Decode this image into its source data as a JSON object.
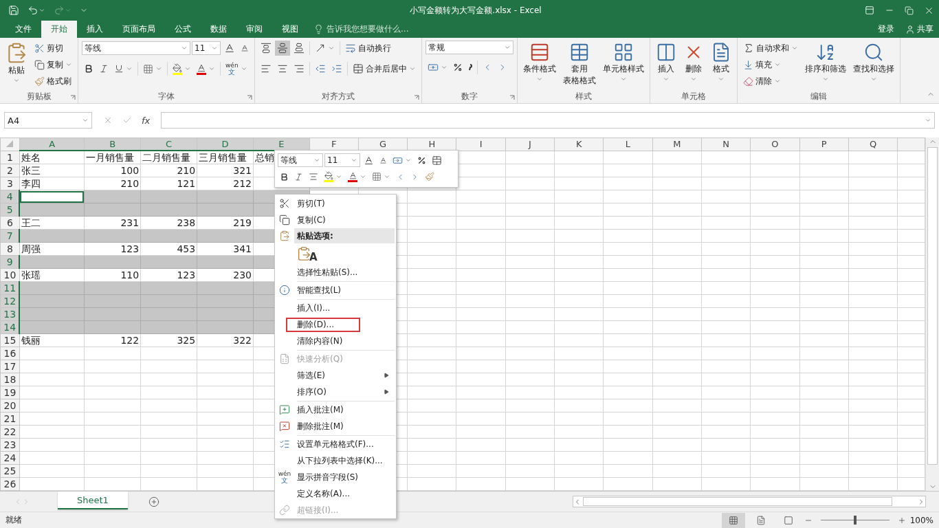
{
  "title_bar": {
    "title": "小写金额转为大写金额.xlsx - Excel"
  },
  "tabs": [
    {
      "label": "文件",
      "selected": false
    },
    {
      "label": "开始",
      "selected": true
    },
    {
      "label": "插入",
      "selected": false
    },
    {
      "label": "页面布局",
      "selected": false
    },
    {
      "label": "公式",
      "selected": false
    },
    {
      "label": "数据",
      "selected": false
    },
    {
      "label": "审阅",
      "selected": false
    },
    {
      "label": "视图",
      "selected": false
    }
  ],
  "tell_me": {
    "placeholder": "告诉我您想要做什么..."
  },
  "account": {
    "sign_in": "登录",
    "share": "共享"
  },
  "ribbon": {
    "groups": [
      {
        "kind": "clipboard",
        "label": "剪贴板",
        "paste": "粘贴",
        "cut": "剪切",
        "copy": "复制",
        "format_painter": "格式刷"
      },
      {
        "kind": "font",
        "label": "字体",
        "font": "等线",
        "size": "11",
        "phonetic_top": "wén",
        "phonetic_bottom": "文"
      },
      {
        "kind": "alignment",
        "label": "对齐方式",
        "middle_selected": true,
        "wrap": "自动换行",
        "merge": "合并后居中"
      },
      {
        "kind": "number",
        "label": "数字",
        "format": "常规"
      },
      {
        "kind": "styles",
        "label": "样式",
        "conditional": "条件格式",
        "table": [
          "套用",
          "表格格式"
        ],
        "cell_styles": "单元格样式"
      },
      {
        "kind": "cells",
        "label": "单元格",
        "insert": "插入",
        "delete": "删除",
        "format": "格式"
      },
      {
        "kind": "editing",
        "label": "编辑",
        "autosum": "自动求和",
        "fill": "填充",
        "clear": "清除",
        "sort": "排序和筛选",
        "find": "查找和选择"
      }
    ]
  },
  "formula_bar": {
    "name_box": "A4",
    "function_label": "fx"
  },
  "sheet": {
    "columns": [
      {
        "label": "A",
        "kind": "text",
        "selected": true
      },
      {
        "label": "B",
        "kind": "number",
        "selected": true
      },
      {
        "label": "C",
        "kind": "number",
        "selected": true
      },
      {
        "label": "D",
        "kind": "number",
        "selected": true
      },
      {
        "label": "E",
        "kind": "number",
        "selected": true
      },
      {
        "label": "F",
        "kind": "number",
        "selected": false
      },
      {
        "label": "G",
        "kind": "number",
        "selected": false
      },
      {
        "label": "H",
        "kind": "number",
        "selected": false
      },
      {
        "label": "I",
        "kind": "number",
        "selected": false
      },
      {
        "label": "J",
        "kind": "number",
        "selected": false
      },
      {
        "label": "K",
        "kind": "number",
        "selected": false
      },
      {
        "label": "L",
        "kind": "number",
        "selected": false
      },
      {
        "label": "M",
        "kind": "number",
        "selected": false
      },
      {
        "label": "N",
        "kind": "number",
        "selected": false
      },
      {
        "label": "O",
        "kind": "number",
        "selected": false
      },
      {
        "label": "P",
        "kind": "number",
        "selected": false
      },
      {
        "label": "Q",
        "kind": "number",
        "selected": false
      }
    ],
    "rows": [
      {
        "number": "1",
        "kind": "header",
        "selected": false,
        "active": false,
        "cells": [
          "姓名",
          "一月销售量",
          "二月销售量",
          "三月销售量",
          "总销"
        ]
      },
      {
        "number": "2",
        "kind": "data",
        "selected": false,
        "active": false,
        "cells": [
          "张三",
          "100",
          "210",
          "321"
        ]
      },
      {
        "number": "3",
        "kind": "data",
        "selected": false,
        "active": false,
        "cells": [
          "李四",
          "210",
          "121",
          "212"
        ]
      },
      {
        "number": "4",
        "kind": "data",
        "selected": true,
        "active": true,
        "cells": []
      },
      {
        "number": "5",
        "kind": "data",
        "selected": true,
        "active": false,
        "cells": []
      },
      {
        "number": "6",
        "kind": "data",
        "selected": false,
        "active": false,
        "cells": [
          "王二",
          "231",
          "238",
          "219"
        ]
      },
      {
        "number": "7",
        "kind": "data",
        "selected": true,
        "active": false,
        "cells": []
      },
      {
        "number": "8",
        "kind": "data",
        "selected": false,
        "active": false,
        "cells": [
          "周强",
          "123",
          "453",
          "341"
        ]
      },
      {
        "number": "9",
        "kind": "data",
        "selected": true,
        "active": false,
        "cells": []
      },
      {
        "number": "10",
        "kind": "data",
        "selected": false,
        "active": false,
        "cells": [
          "张瑶",
          "110",
          "123",
          "230"
        ]
      },
      {
        "number": "11",
        "kind": "data",
        "selected": true,
        "active": false,
        "cells": []
      },
      {
        "number": "12",
        "kind": "data",
        "selected": true,
        "active": false,
        "cells": []
      },
      {
        "number": "13",
        "kind": "data",
        "selected": true,
        "active": false,
        "cells": []
      },
      {
        "number": "14",
        "kind": "data",
        "selected": true,
        "active": false,
        "cells": []
      },
      {
        "number": "15",
        "kind": "data",
        "selected": false,
        "active": false,
        "cells": [
          "钱丽",
          "122",
          "325",
          "322"
        ]
      },
      {
        "number": "16",
        "kind": "data",
        "selected": false,
        "active": false,
        "cells": []
      },
      {
        "number": "17",
        "kind": "data",
        "selected": false,
        "active": false,
        "cells": []
      },
      {
        "number": "18",
        "kind": "data",
        "selected": false,
        "active": false,
        "cells": []
      },
      {
        "number": "19",
        "kind": "data",
        "selected": false,
        "active": false,
        "cells": []
      },
      {
        "number": "20",
        "kind": "data",
        "selected": false,
        "active": false,
        "cells": []
      },
      {
        "number": "21",
        "kind": "data",
        "selected": false,
        "active": false,
        "cells": []
      },
      {
        "number": "22",
        "kind": "data",
        "selected": false,
        "active": false,
        "cells": []
      },
      {
        "number": "23",
        "kind": "data",
        "selected": false,
        "active": false,
        "cells": []
      },
      {
        "number": "24",
        "kind": "data",
        "selected": false,
        "active": false,
        "cells": []
      },
      {
        "number": "25",
        "kind": "data",
        "selected": false,
        "active": false,
        "cells": []
      },
      {
        "number": "26",
        "kind": "data",
        "selected": false,
        "active": false,
        "cells": []
      }
    ]
  },
  "mini_toolbar": {
    "font": "等线",
    "size": "11"
  },
  "context_menu": {
    "items": [
      {
        "kind": "item",
        "label": "剪切(T)",
        "disabled": false,
        "submenu": false,
        "highlighted": false,
        "separator_after": false
      },
      {
        "kind": "item",
        "label": "复制(C)",
        "disabled": false,
        "submenu": false,
        "highlighted": false,
        "separator_after": false
      },
      {
        "kind": "header",
        "label": "粘贴选项:",
        "separator_after": false
      },
      {
        "kind": "paste_options",
        "label": "A",
        "separator_after": false
      },
      {
        "kind": "item",
        "label": "选择性粘贴(S)...",
        "disabled": false,
        "submenu": false,
        "highlighted": false,
        "separator_after": true
      },
      {
        "kind": "item",
        "label": "智能查找(L)",
        "disabled": false,
        "submenu": false,
        "highlighted": false,
        "separator_after": true
      },
      {
        "kind": "item",
        "label": "插入(I)...",
        "disabled": false,
        "submenu": false,
        "highlighted": false,
        "separator_after": false
      },
      {
        "kind": "item",
        "label": "删除(D)...",
        "disabled": false,
        "submenu": false,
        "highlighted": true,
        "separator_after": false
      },
      {
        "kind": "item",
        "label": "清除内容(N)",
        "disabled": false,
        "submenu": false,
        "highlighted": false,
        "separator_after": true
      },
      {
        "kind": "item",
        "label": "快速分析(Q)",
        "disabled": true,
        "submenu": false,
        "highlighted": false,
        "separator_after": false
      },
      {
        "kind": "item",
        "label": "筛选(E)",
        "disabled": false,
        "submenu": true,
        "highlighted": false,
        "separator_after": false
      },
      {
        "kind": "item",
        "label": "排序(O)",
        "disabled": false,
        "submenu": true,
        "highlighted": false,
        "separator_after": true
      },
      {
        "kind": "item",
        "label": "插入批注(M)",
        "disabled": false,
        "submenu": false,
        "highlighted": false,
        "separator_after": false
      },
      {
        "kind": "item",
        "label": "删除批注(M)",
        "disabled": false,
        "submenu": false,
        "highlighted": false,
        "separator_after": true
      },
      {
        "kind": "item",
        "label": "设置单元格格式(F)...",
        "disabled": false,
        "submenu": false,
        "highlighted": false,
        "separator_after": false
      },
      {
        "kind": "item",
        "label": "从下拉列表中选择(K)...",
        "disabled": false,
        "submenu": false,
        "highlighted": false,
        "separator_after": false
      },
      {
        "kind": "phonetic",
        "label": "显示拼音字段(S)",
        "icon_top": "wén",
        "icon_bottom": "文",
        "disabled": false,
        "submenu": false,
        "highlighted": false,
        "separator_after": false
      },
      {
        "kind": "item",
        "label": "定义名称(A)...",
        "disabled": false,
        "submenu": false,
        "highlighted": false,
        "separator_after": false
      },
      {
        "kind": "item",
        "label": "超链接(I)...",
        "disabled": true,
        "submenu": false,
        "highlighted": false,
        "separator_after": false
      }
    ]
  },
  "sheet_tabs": [
    {
      "label": "Sheet1",
      "selected": true
    }
  ],
  "status_bar": {
    "status": "就绪",
    "views": [
      {
        "kind": "normal",
        "selected": true
      },
      {
        "kind": "page_layout",
        "selected": false
      },
      {
        "kind": "page_break",
        "selected": false
      }
    ],
    "zoom": {
      "level": 0.5,
      "reading": "100%"
    }
  }
}
